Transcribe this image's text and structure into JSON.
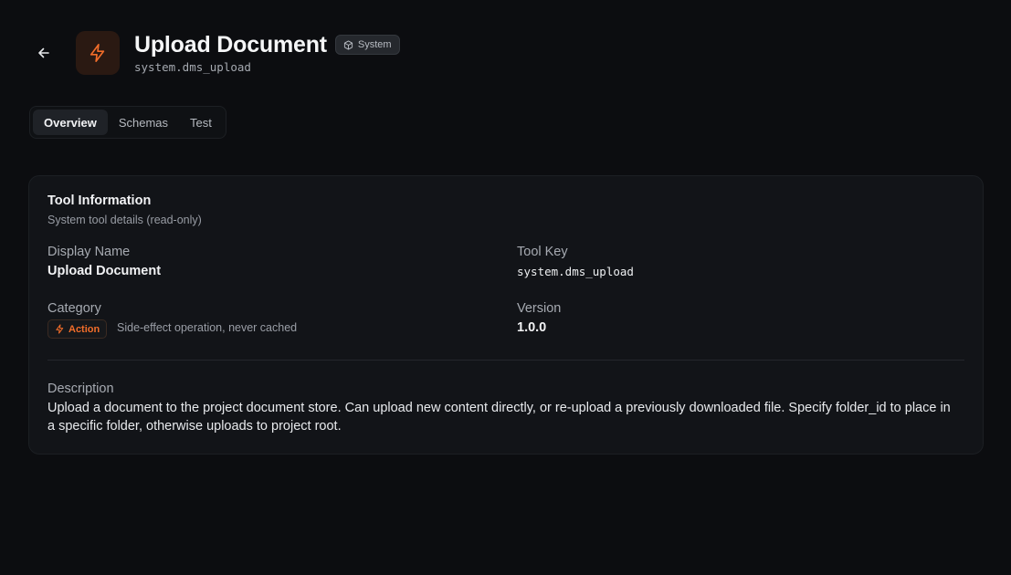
{
  "header": {
    "title": "Upload Document",
    "badge": "System",
    "tool_key": "system.dms_upload"
  },
  "tabs": [
    {
      "label": "Overview",
      "active": true
    },
    {
      "label": "Schemas",
      "active": false
    },
    {
      "label": "Test",
      "active": false
    }
  ],
  "card": {
    "title": "Tool Information",
    "subtitle": "System tool details (read-only)",
    "display_name": {
      "label": "Display Name",
      "value": "Upload Document"
    },
    "tool_key": {
      "label": "Tool Key",
      "value": "system.dms_upload"
    },
    "category": {
      "label": "Category",
      "badge": "Action",
      "note": "Side-effect operation, never cached"
    },
    "version": {
      "label": "Version",
      "value": "1.0.0"
    },
    "description": {
      "label": "Description",
      "value": "Upload a document to the project document store. Can upload new content directly, or re-upload a previously downloaded file. Specify folder_id to place in a specific folder, otherwise uploads to project root."
    }
  },
  "colors": {
    "accent": "#f26d2a",
    "background": "#0c0d10",
    "card": "#121418"
  },
  "icons": {
    "back": "arrow-left-icon",
    "tool": "lightning-bolt-icon",
    "badge": "cube-icon",
    "action": "lightning-bolt-icon"
  }
}
